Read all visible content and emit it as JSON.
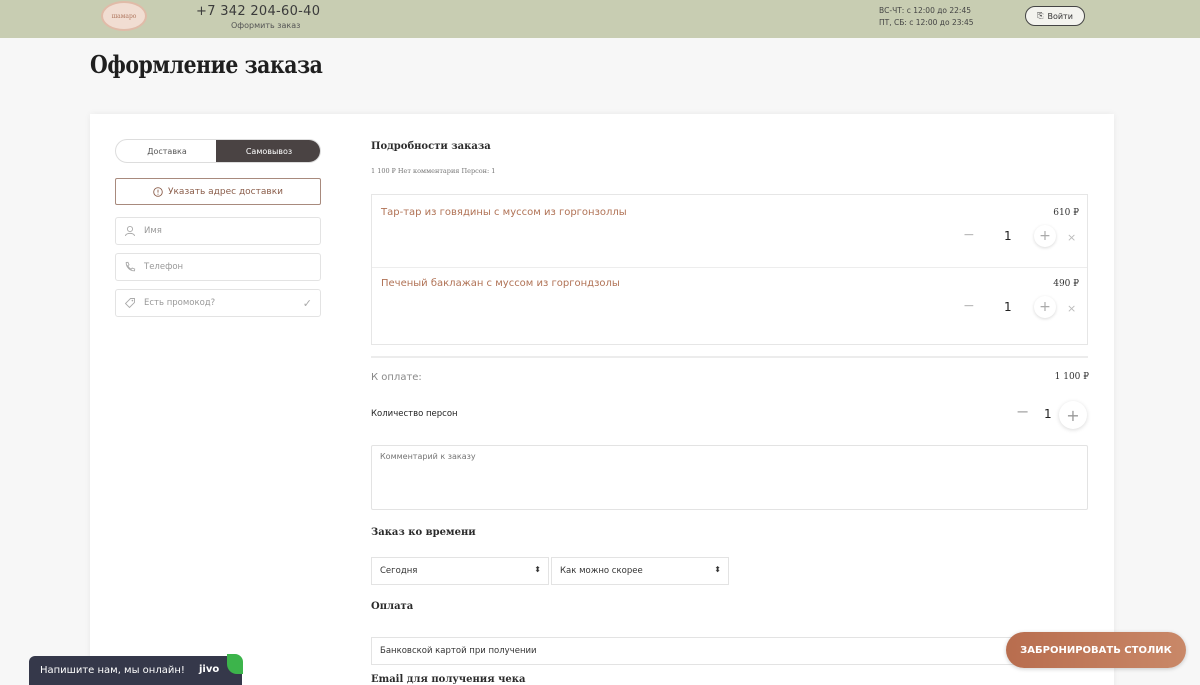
{
  "header": {
    "logo_text": "шамаро",
    "phone": "+7 342 204-60-40",
    "order_link": "Оформить заказ",
    "hours_line1": "ВС-ЧТ: с 12:00 до 22:45",
    "hours_line2": "ПТ, СБ: с 12:00 до 23:45",
    "login": "Войти"
  },
  "page": {
    "title": "Оформление заказа"
  },
  "left": {
    "toggle": {
      "delivery": "Доставка",
      "pickup": "Самовывоз"
    },
    "address_button": "Указать адрес доставки",
    "name_placeholder": "Имя",
    "phone_placeholder": "Телефон",
    "promo_placeholder": "Есть промокод?"
  },
  "order": {
    "details_title": "Подробности заказа",
    "summary": "1 100 ₽   Нет комментария   Персон: 1",
    "items": [
      {
        "name": "Тар-тар из говядины с муссом из горгонзоллы",
        "price": "610 ₽",
        "qty": "1"
      },
      {
        "name": "Печеный баклажан с муссом из горгондзолы",
        "price": "490 ₽",
        "qty": "1"
      }
    ],
    "pay_label": "К оплате:",
    "pay_amount": "1 100 ₽",
    "persons_label": "Количество персон",
    "persons_qty": "1",
    "comment_placeholder": "Комментарий к заказу",
    "time_title": "Заказ ко времени",
    "day_value": "Сегодня",
    "time_value": "Как можно скорее",
    "payment_title": "Оплата",
    "payment_value": "Банковской картой при получении",
    "email_title": "Email для получения чека"
  },
  "floating": {
    "book_button": "ЗАБРОНИРОВАТЬ СТОЛИК",
    "chat_text": "Напишите нам, мы онлайн!",
    "chat_brand": "jivo"
  },
  "icons": {
    "minus": "−",
    "plus": "+",
    "remove": "×",
    "check": "✓",
    "arrows": "⬍"
  },
  "colors": {
    "header_bg": "#c8cdb2",
    "accent": "#b07255",
    "dark_toggle": "#4a4343",
    "book_btn": "#c0785a"
  }
}
